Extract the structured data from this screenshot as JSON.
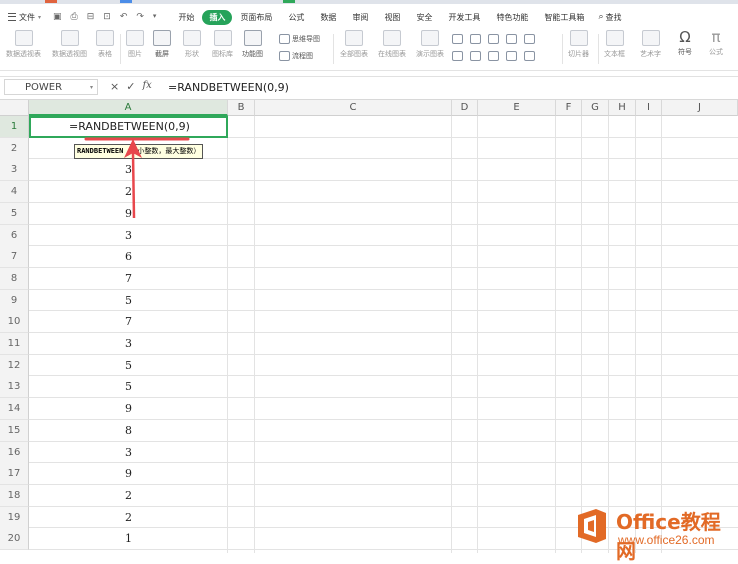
{
  "menubar": {
    "file_label": "文件",
    "menus": [
      "开始",
      "插入",
      "页面布局",
      "公式",
      "数据",
      "审阅",
      "视图",
      "安全",
      "开发工具",
      "特色功能",
      "智能工具箱"
    ],
    "active_menu": "插入",
    "search_label": "查找"
  },
  "ribbon": {
    "items": {
      "pivot_table": "数据透视表",
      "pivot_chart": "数据透视图",
      "table": "表格",
      "picture": "图片",
      "screenshot": "截屏",
      "shape": "形状",
      "icon_lib": "图标库",
      "func_chart": "功能图",
      "mindmap": "思维导图",
      "flowchart": "流程图",
      "all_charts": "全部图表",
      "online_chart": "在线图表",
      "demo_chart": "演示图表",
      "slicer": "切片器",
      "textbox": "文本框",
      "art_text": "艺术字",
      "symbol": "符号",
      "formula": "公式"
    }
  },
  "formula_bar": {
    "name_box": "POWER",
    "cancel_icon": "×",
    "confirm_icon": "✓",
    "fx_label": "fx",
    "formula": "=RANDBETWEEN(0,9)"
  },
  "grid": {
    "columns": [
      "A",
      "B",
      "C",
      "D",
      "E",
      "F",
      "G",
      "H",
      "I",
      "J"
    ],
    "rows": [
      "1",
      "2",
      "3",
      "4",
      "5",
      "6",
      "7",
      "8",
      "9",
      "10",
      "11",
      "12",
      "13",
      "14",
      "15",
      "16",
      "17",
      "18",
      "19",
      "20"
    ],
    "active_cell_text": "=RANDBETWEEN(0,9)",
    "column_a_values": [
      "",
      "",
      "3",
      "2",
      "9",
      "3",
      "6",
      "7",
      "5",
      "7",
      "3",
      "5",
      "5",
      "9",
      "8",
      "3",
      "9",
      "2",
      "2",
      "1"
    ],
    "tooltip": {
      "func": "RANDBETWEEN",
      "args": "（最小整数，最大整数）"
    }
  },
  "watermark": {
    "title": "Office教程网",
    "url": "www.office26.com"
  },
  "colors": {
    "accent": "#2fa85a",
    "annotation": "#e8474c",
    "watermark": "#e26a26"
  }
}
